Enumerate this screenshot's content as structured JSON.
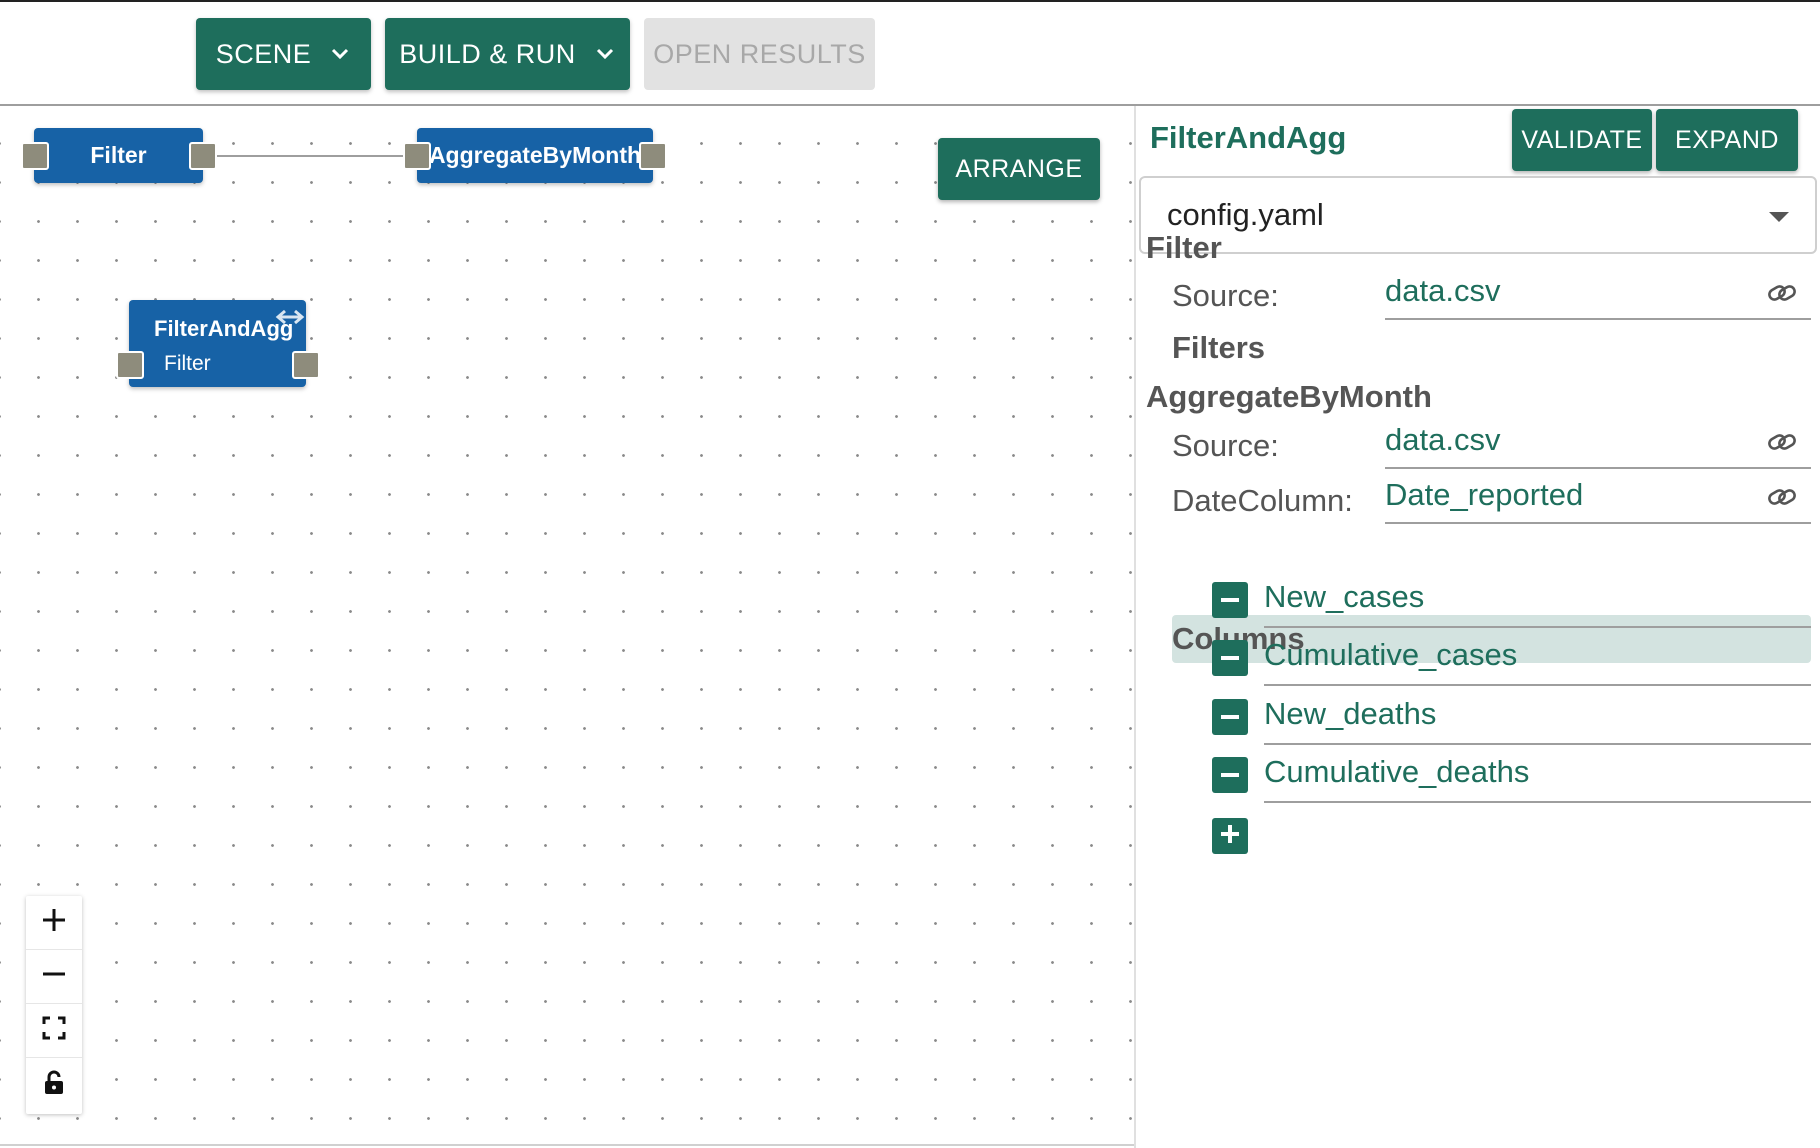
{
  "toolbar": {
    "scene_label": "SCENE",
    "build_run_label": "BUILD & RUN",
    "open_results_label": "OPEN RESULTS"
  },
  "canvas": {
    "arrange_label": "ARRANGE",
    "nodes": {
      "filter": {
        "label": "Filter"
      },
      "aggregate": {
        "label": "AggregateByMonth"
      },
      "group": {
        "title": "FilterAndAgg",
        "inner_label": "Filter"
      }
    },
    "zoom_controls": [
      "zoom-in-icon",
      "zoom-out-icon",
      "fit-view-icon",
      "lock-icon"
    ]
  },
  "panel": {
    "title": "FilterAndAgg",
    "validate_label": "VALIDATE",
    "expand_label": "EXPAND",
    "file_select_value": "config.yaml",
    "filter_section": {
      "title": "Filter",
      "source_label": "Source:",
      "source_value": "data.csv",
      "filters_label": "Filters"
    },
    "aggregate_section": {
      "title": "AggregateByMonth",
      "source_label": "Source:",
      "source_value": "data.csv",
      "date_column_label": "DateColumn:",
      "date_column_value": "Date_reported",
      "columns_label": "Columns",
      "columns": [
        "New_cases",
        "Cumulative_cases",
        "New_deaths",
        "Cumulative_deaths"
      ]
    }
  },
  "colors": {
    "primary_green": "#1e6e5c",
    "node_blue": "#1762a6",
    "port_gray": "#8e8c7c",
    "columns_band": "#d3e3e0"
  }
}
